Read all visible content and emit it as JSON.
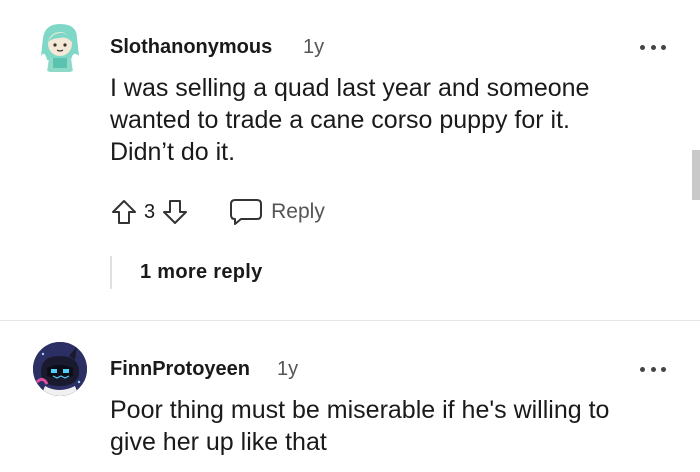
{
  "comments": [
    {
      "username": "Slothanonymous",
      "age": "1y",
      "body": "I was selling a quad last year and someone\nwanted to trade a cane corso puppy for it.\nDidn’t do it.",
      "votes": "3",
      "reply_label": "Reply",
      "more_replies_label": "1 more reply",
      "avatar_icon": "sloth-avatar-icon"
    },
    {
      "username": "FinnProtoyeen",
      "age": "1y",
      "body": "Poor thing must be miserable if he's willing to\ngive her up like that",
      "avatar_icon": "protogen-avatar-icon"
    }
  ],
  "colors": {
    "text": "#1a1a1b",
    "muted": "#555555",
    "divider": "#e6e6e6"
  }
}
